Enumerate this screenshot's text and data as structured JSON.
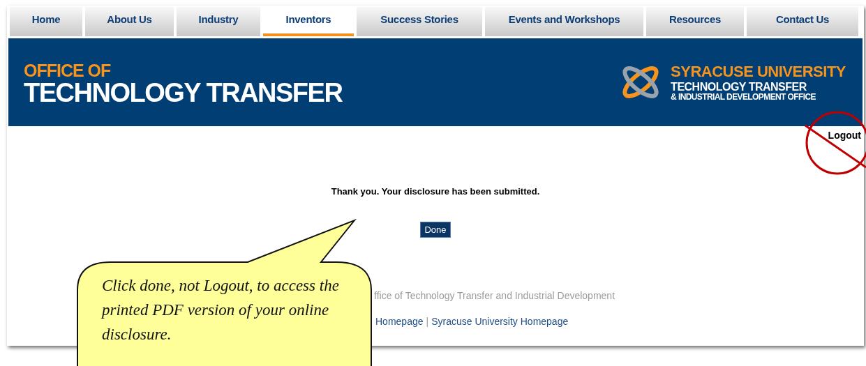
{
  "nav": [
    {
      "label": "Home",
      "selected": false
    },
    {
      "label": "About Us",
      "selected": false
    },
    {
      "label": "Industry",
      "selected": false
    },
    {
      "label": "Inventors",
      "selected": true
    },
    {
      "label": "Success Stories",
      "selected": false
    },
    {
      "label": "Events and Workshops",
      "selected": false
    },
    {
      "label": "Resources",
      "selected": false
    },
    {
      "label": "Contact Us",
      "selected": false
    }
  ],
  "banner": {
    "office_of": "OFFICE OF",
    "title": "TECHNOLOGY TRANSFER",
    "university": "SYRACUSE UNIVERSITY",
    "unit_line_1": "TECHNOLOGY TRANSFER",
    "unit_line_2": "& INDUSTRIAL DEVELOPMENT OFFICE"
  },
  "logout": "Logout",
  "message": "Thank you. Your disclosure has been submitted.",
  "done_button": "Done",
  "footer": {
    "line_1": "ffice of Technology Transfer and Industrial Development",
    "links": [
      "Homepage",
      "Syracuse University Homepage"
    ],
    "separator": "|"
  },
  "callout": {
    "text": "Click done, not Logout, to access the printed PDF version of your online disclosure."
  }
}
